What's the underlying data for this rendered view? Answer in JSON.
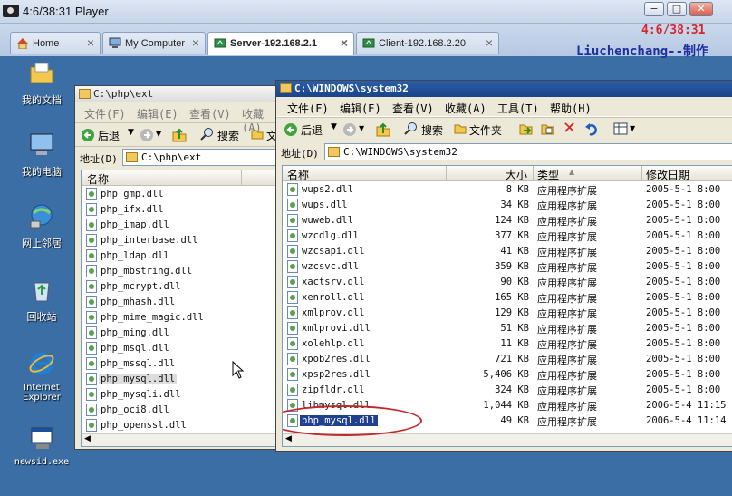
{
  "player": {
    "title": "4:6/38:31 Player",
    "buttons": {
      "minimize": "−",
      "maximize": "□",
      "close": "✕"
    }
  },
  "tabs": [
    {
      "label": "Home",
      "icon": "home-icon"
    },
    {
      "label": "My Computer",
      "icon": "computer-icon"
    },
    {
      "label": "Server-192.168.2.1",
      "icon": "vm-icon"
    },
    {
      "label": "Client-192.168.2.20",
      "icon": "vm-icon"
    }
  ],
  "overlay": {
    "time": "4:6/38:31",
    "credit": "Liuchenchang--制作"
  },
  "desktop": {
    "icons": [
      "我的文档",
      "我的电脑",
      "网上邻居",
      "回收站",
      "Internet Explorer",
      "newsid.exe"
    ]
  },
  "left_window": {
    "title": "C:\\php\\ext",
    "menu": [
      "文件(F)",
      "编辑(E)",
      "查看(V)",
      "收藏(A)"
    ],
    "toolbar": {
      "back": "后退",
      "search": "搜索",
      "folders": "文"
    },
    "address_label": "地址(D)",
    "address_value": "C:\\php\\ext",
    "col_name": "名称",
    "files": [
      "php_gmp.dll",
      "php_ifx.dll",
      "php_imap.dll",
      "php_interbase.dll",
      "php_ldap.dll",
      "php_mbstring.dll",
      "php_mcrypt.dll",
      "php_mhash.dll",
      "php_mime_magic.dll",
      "php_ming.dll",
      "php_msql.dll",
      "php_mssql.dll",
      "php_mysql.dll",
      "php_mysqli.dll",
      "php_oci8.dll",
      "php_openssl.dll"
    ],
    "selected_index": 12
  },
  "right_window": {
    "title": "C:\\WINDOWS\\system32",
    "menu": [
      "文件(F)",
      "编辑(E)",
      "查看(V)",
      "收藏(A)",
      "工具(T)",
      "帮助(H)"
    ],
    "toolbar": {
      "back": "后退",
      "search": "搜索",
      "folders": "文件夹"
    },
    "address_label": "地址(D)",
    "address_value": "C:\\WINDOWS\\system32",
    "columns": {
      "name": "名称",
      "size": "大小",
      "type": "类型",
      "modified": "修改日期"
    },
    "files": [
      {
        "name": "wups2.dll",
        "size": "8 KB",
        "type": "应用程序扩展",
        "modified": "2005-5-1 8:00"
      },
      {
        "name": "wups.dll",
        "size": "34 KB",
        "type": "应用程序扩展",
        "modified": "2005-5-1 8:00"
      },
      {
        "name": "wuweb.dll",
        "size": "124 KB",
        "type": "应用程序扩展",
        "modified": "2005-5-1 8:00"
      },
      {
        "name": "wzcdlg.dll",
        "size": "377 KB",
        "type": "应用程序扩展",
        "modified": "2005-5-1 8:00"
      },
      {
        "name": "wzcsapi.dll",
        "size": "41 KB",
        "type": "应用程序扩展",
        "modified": "2005-5-1 8:00"
      },
      {
        "name": "wzcsvc.dll",
        "size": "359 KB",
        "type": "应用程序扩展",
        "modified": "2005-5-1 8:00"
      },
      {
        "name": "xactsrv.dll",
        "size": "90 KB",
        "type": "应用程序扩展",
        "modified": "2005-5-1 8:00"
      },
      {
        "name": "xenroll.dll",
        "size": "165 KB",
        "type": "应用程序扩展",
        "modified": "2005-5-1 8:00"
      },
      {
        "name": "xmlprov.dll",
        "size": "129 KB",
        "type": "应用程序扩展",
        "modified": "2005-5-1 8:00"
      },
      {
        "name": "xmlprovi.dll",
        "size": "51 KB",
        "type": "应用程序扩展",
        "modified": "2005-5-1 8:00"
      },
      {
        "name": "xolehlp.dll",
        "size": "11 KB",
        "type": "应用程序扩展",
        "modified": "2005-5-1 8:00"
      },
      {
        "name": "xpob2res.dll",
        "size": "721 KB",
        "type": "应用程序扩展",
        "modified": "2005-5-1 8:00"
      },
      {
        "name": "xpsp2res.dll",
        "size": "5,406 KB",
        "type": "应用程序扩展",
        "modified": "2005-5-1 8:00"
      },
      {
        "name": "zipfldr.dll",
        "size": "324 KB",
        "type": "应用程序扩展",
        "modified": "2005-5-1 8:00"
      },
      {
        "name": "libmysql.dll",
        "size": "1,044 KB",
        "type": "应用程序扩展",
        "modified": "2006-5-4 11:15"
      },
      {
        "name": "php_mysql.dll",
        "size": "49 KB",
        "type": "应用程序扩展",
        "modified": "2006-5-4 11:14"
      }
    ],
    "selected_index": 15
  }
}
